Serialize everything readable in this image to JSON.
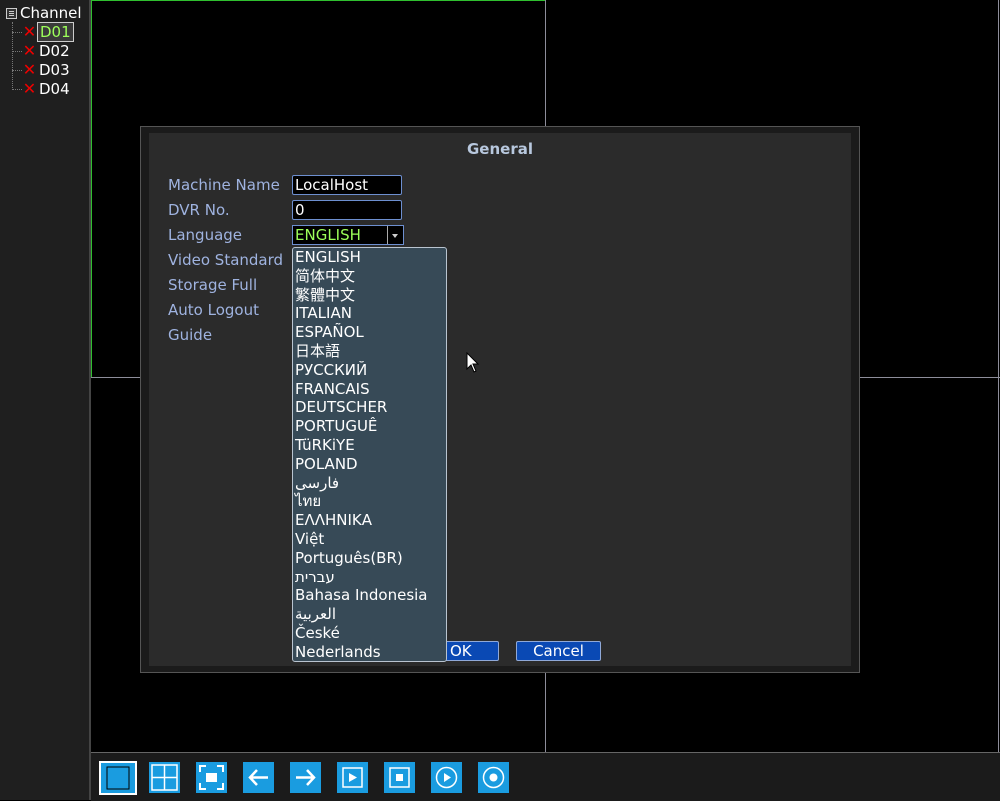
{
  "sidebar": {
    "root_label": "Channel",
    "channels": [
      {
        "label": "D01",
        "selected": true
      },
      {
        "label": "D02",
        "selected": false
      },
      {
        "label": "D03",
        "selected": false
      },
      {
        "label": "D04",
        "selected": false
      }
    ]
  },
  "dialog": {
    "title": "General",
    "labels": {
      "machine_name": "Machine Name",
      "dvr_no": "DVR No.",
      "language": "Language",
      "video_standard": "Video Standard",
      "storage_full": "Storage Full",
      "auto_logout": "Auto Logout",
      "guide": "Guide"
    },
    "values": {
      "machine_name": "LocalHost",
      "dvr_no": "0",
      "language": "ENGLISH"
    },
    "language_options": [
      "ENGLISH",
      "简体中文",
      "繁體中文",
      "ITALIAN",
      "ESPAÑOL",
      "日本語",
      "РУССКИЙ",
      "FRANCAIS",
      "DEUTSCHER",
      "PORTUGUÊ",
      "TüRKiYE",
      "POLAND",
      "فارسی",
      "ไทย",
      "ΕΛΛΗΝΙΚΑ",
      "Việt",
      "Português(BR)",
      "עברית",
      "Bahasa Indonesia",
      "العربية",
      "České",
      "Nederlands"
    ],
    "ok_label": "OK",
    "cancel_label": "Cancel"
  },
  "toolbar": {
    "buttons": [
      "single-view-icon",
      "quad-view-icon",
      "fullscreen-icon",
      "arrow-left-icon",
      "arrow-right-icon",
      "play-icon",
      "record-icon",
      "playback-icon",
      "stop-circle-icon"
    ]
  },
  "colors": {
    "accent_blue": "#1a9ce0",
    "label_text": "#9fb3e0",
    "selected_value": "#9dff5a",
    "button_blue": "#0a49b4",
    "dropdown_bg": "#374a57",
    "active_cell_border": "#2fbf2f"
  }
}
